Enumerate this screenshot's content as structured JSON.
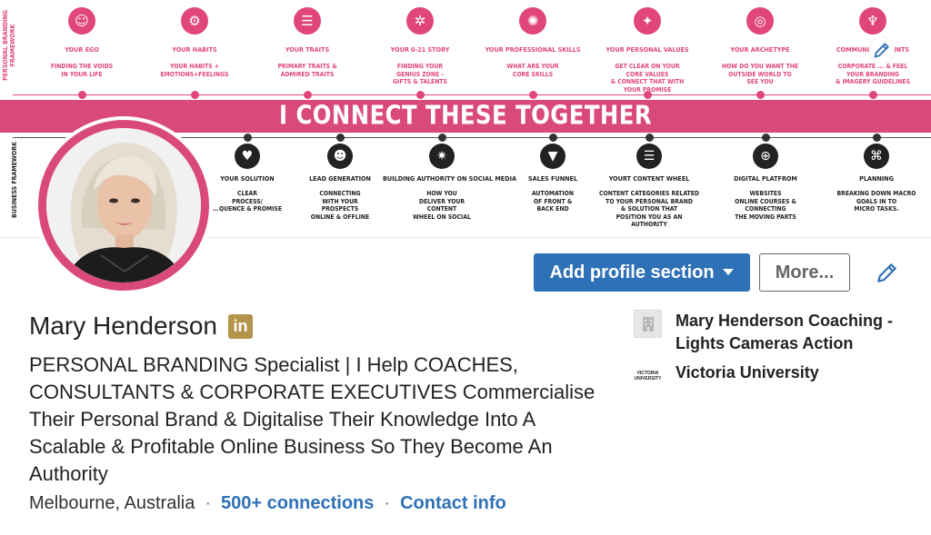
{
  "banner": {
    "side_label_top": "PERSONAL BRANDING\nFRAMEWORK",
    "side_label_bottom": "BUSINESS FRAMEWORK",
    "center_text": "I CONNECT THESE  TOGETHER",
    "top_items": [
      {
        "title": "YOUR EGO",
        "desc": "FINDING THE VOIDS\nIN YOUR LIFE"
      },
      {
        "title": "YOUR HABITS",
        "desc": "YOUR HABITS +\nEMOTIONS+FEELINGS"
      },
      {
        "title": "YOUR TRAITS",
        "desc": "PRIMARY TRAITS &\nADMIRED TRAITS"
      },
      {
        "title": "YOUR  0-21 STORY",
        "desc": "FINDING YOUR\nGENIUS ZONE -\nGIFTS & TALENTS"
      },
      {
        "title": "YOUR  PROFESSIONAL SKILLS",
        "desc": "WHAT ARE YOUR\nCORE SKILLS"
      },
      {
        "title": "YOUR PERSONAL VALUES",
        "desc": "GET CLEAR ON YOUR\nCORE VALUES\n& CONNECT  THAT WITH\nYOUR PROMISE"
      },
      {
        "title": "YOUR  ARCHETYPE",
        "desc": "HOW DO YOU WANT THE\nOUTSIDE WORLD TO\nSEE YOU"
      },
      {
        "title": "COMMUNICA  ...  OINTS",
        "desc": "CORPORATE  ...  & FEEL\nYOUR BRANDING\n& IMAGERY GUIDELINES"
      }
    ],
    "bottom_items": [
      {
        "title": "YOUR  SOLUTION",
        "desc": "CLEAR\nPROCESS/\n...QUENCE & PROMISE"
      },
      {
        "title": "LEAD GENERATION",
        "desc": "CONNECTING\nWITH YOUR\nPROSPECTS\nONLINE & OFFLINE"
      },
      {
        "title": "BUILDING  AUTHORITY  ON SOCIAL MEDIA",
        "desc": "HOW YOU\nDELIVER YOUR\nCONTENT\nWHEEL ON SOCIAL"
      },
      {
        "title": "SALES FUNNEL",
        "desc": "AUTOMATION\nOF FRONT &\nBACK END"
      },
      {
        "title": "YOURT CONTENT WHEEL",
        "desc": "CONTENT CATEGORIES RELATED\nTO YOUR PERSONAL BRAND\n& SOLUTION THAT\nPOSITION YOU AS AN\nAUTHORITY"
      },
      {
        "title": "DIGITAL PLATFROM",
        "desc": "WEBSITES\nONLINE COURSES &\nCONNECTING\nTHE MOVING PARTS"
      },
      {
        "title": "PLANNING",
        "desc": "BREAKING DOWN MACRO\nGOALS IN TO\nMICRO TASKS."
      }
    ],
    "edit_icon": "pencil-icon"
  },
  "actions": {
    "add_section_label": "Add profile section",
    "more_label": "More..."
  },
  "profile": {
    "name": "Mary Henderson",
    "badge": "in",
    "headline": "PERSONAL BRANDING Specialist | I Help COACHES, CONSULTANTS & CORPORATE EXECUTIVES Commercialise Their Personal Brand & Digitalise Their Knowledge Into A Scalable & Profitable Online Business So They Become An Authority",
    "location": "Melbourne, Australia",
    "connections": "500+ connections",
    "contact": "Contact info"
  },
  "experience": {
    "company": "Mary Henderson Coaching - Lights Cameras Action",
    "school": "Victoria University",
    "school_logo_text": "VICTORIA\nUNIVERSITY"
  },
  "colors": {
    "brand_pink": "#d94a7b",
    "linkedin_blue": "#2f71b6",
    "premium_gold": "#b4944a"
  }
}
